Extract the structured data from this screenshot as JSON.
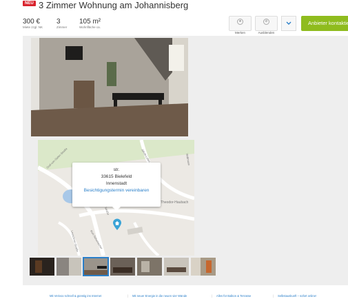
{
  "listing": {
    "badge": "NEU",
    "title": "3 Zimmer Wohnung am Johannisberg"
  },
  "facts": [
    {
      "value": "300 €",
      "label": "Miete zzgl. NK"
    },
    {
      "value": "3",
      "label": "Zimmer"
    },
    {
      "value": "105 m²",
      "label": "Wohnfläche ca."
    }
  ],
  "actions": {
    "bookmark_label": "Merken",
    "hide_label": "Ausblenden",
    "more_icon": "chevron-down-icon",
    "contact_label": "Anbieter kontaktieren"
  },
  "map": {
    "street": "str.",
    "city": "33615 Bielefeld",
    "district": "Innenstadt",
    "appointment_link": "Besichtigungstermin vereinbaren",
    "street_labels": [
      "Graf-von-Galen-Straße",
      "Jakob-Leber-Straße",
      "Theodor-Haubach",
      "Leuschner-Straße",
      "Kurt-Schumacher",
      "Straße",
      "Wallmann"
    ],
    "marker_icon": "home-pin-icon"
  },
  "thumbnails": {
    "count": 7,
    "selected_index": 2
  },
  "footer": {
    "links": [
      "Mit Verivox schnell & günstig ins Internet",
      "Mit neuer Energie in die neuen vier Wände",
      "Alles für Balkon & Terrasse",
      "Selbstauskunft – sofort online!"
    ]
  },
  "colors": {
    "accent": "#2a7fc9",
    "contact": "#8fbc1e",
    "badge": "#d9232d"
  }
}
